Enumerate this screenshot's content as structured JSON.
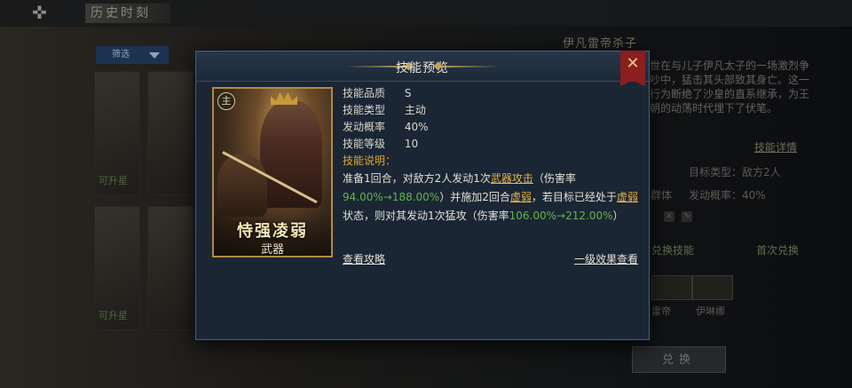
{
  "background": {
    "header_title": "历史时刻",
    "filter_label": "筛选",
    "card_tags": [
      "可升星",
      "可升星"
    ],
    "right_title": "伊凡雷帝杀子",
    "right_desc": "世在与儿子伊凡太子的一场激烈争吵中，猛击其头部致其身亡。这一行为断绝了沙皇的直系继承，为王朝的动荡时代埋下了伏笔。",
    "details_link": "技能详情",
    "target_type": "目标类型：敌方2人",
    "trigger_rate": "发动概率：40%",
    "partial_label": "群体",
    "exchange_skill": "兑换技能",
    "first_exchange": "首次兑换",
    "names": [
      "雷帝",
      "伊琳娜"
    ],
    "confirm_button": "兑换"
  },
  "dialog": {
    "title": "技能预览",
    "close_icon": "crossed-swords-close-icon",
    "card": {
      "badge": "主",
      "name": "恃强凌弱",
      "type": "武器"
    },
    "stats": [
      {
        "key": "技能品质",
        "value": "S"
      },
      {
        "key": "技能类型",
        "value": "主动"
      },
      {
        "key": "发动概率",
        "value": "40%"
      },
      {
        "key": "技能等级",
        "value": "10"
      }
    ],
    "desc_label": "技能说明：",
    "desc": {
      "p1": "准备1回合，对敌方2人发动1次",
      "link1": "武器攻击",
      "p2": "（伤害率",
      "g1": "94.00%→188.00%",
      "p3": "）并施加2回合",
      "link2": "虚弱",
      "p4": "，若目标已经处于",
      "link3": "虚弱",
      "p5": "状态，则对其发动1次猛攻（伤害率",
      "g2": "106.00%→212.00%",
      "p6": "）"
    },
    "guide_link": "查看攻略",
    "level1_link": "一级效果查看"
  },
  "colors": {
    "accent_gold": "#e0a52e",
    "value_green": "#62b54a",
    "close_red": "#8b1e1e",
    "dialog_bg": "#1a2634"
  }
}
